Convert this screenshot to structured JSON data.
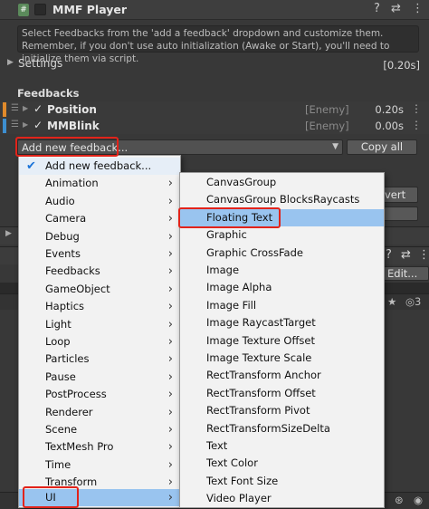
{
  "header": {
    "title": "MMF Player",
    "script_icon": "#",
    "help_icon": "?",
    "settings_icon": "⇄",
    "more_icon": "⋮"
  },
  "help_text": "Select Feedbacks from the 'add a feedback' dropdown and customize them. Remember, if you don't use auto initialization (Awake or Start), you'll need to initialize them via script.",
  "settings": {
    "label": "Settings",
    "duration": "[0.20s]"
  },
  "feedbacks": {
    "title": "Feedbacks",
    "items": [
      {
        "name": "Position",
        "tag": "[Enemy]",
        "time": "0.20s",
        "color": "#e08a2b"
      },
      {
        "name": "MMBlink",
        "tag": "[Enemy]",
        "time": "0.00s",
        "color": "#3d8fd0"
      }
    ]
  },
  "add_dropdown": {
    "label": "Add new feedback...",
    "copy_all": "Copy all"
  },
  "background_fragments": {
    "revert": "vert",
    "edit": "Edit..."
  },
  "menu_main": {
    "items": [
      {
        "label": "Add new feedback...",
        "checked": true,
        "submenu": false
      },
      {
        "label": "Animation",
        "submenu": true
      },
      {
        "label": "Audio",
        "submenu": true
      },
      {
        "label": "Camera",
        "submenu": true
      },
      {
        "label": "Debug",
        "submenu": true
      },
      {
        "label": "Events",
        "submenu": true
      },
      {
        "label": "Feedbacks",
        "submenu": true
      },
      {
        "label": "GameObject",
        "submenu": true
      },
      {
        "label": "Haptics",
        "submenu": true
      },
      {
        "label": "Light",
        "submenu": true
      },
      {
        "label": "Loop",
        "submenu": true
      },
      {
        "label": "Particles",
        "submenu": true
      },
      {
        "label": "Pause",
        "submenu": true
      },
      {
        "label": "PostProcess",
        "submenu": true
      },
      {
        "label": "Renderer",
        "submenu": true
      },
      {
        "label": "Scene",
        "submenu": true
      },
      {
        "label": "TextMesh Pro",
        "submenu": true
      },
      {
        "label": "Time",
        "submenu": true
      },
      {
        "label": "Transform",
        "submenu": true
      },
      {
        "label": "UI",
        "submenu": true,
        "selected": true
      }
    ]
  },
  "menu_ui": {
    "items": [
      {
        "label": "CanvasGroup"
      },
      {
        "label": "CanvasGroup BlocksRaycasts"
      },
      {
        "label": "Floating Text",
        "selected": true
      },
      {
        "label": "Graphic"
      },
      {
        "label": "Graphic CrossFade"
      },
      {
        "label": "Image"
      },
      {
        "label": "Image Alpha"
      },
      {
        "label": "Image Fill"
      },
      {
        "label": "Image RaycastTarget"
      },
      {
        "label": "Image Texture Offset"
      },
      {
        "label": "Image Texture Scale"
      },
      {
        "label": "RectTransform Anchor"
      },
      {
        "label": "RectTransform Offset"
      },
      {
        "label": "RectTransform Pivot"
      },
      {
        "label": "RectTransformSizeDelta"
      },
      {
        "label": "Text"
      },
      {
        "label": "Text Color"
      },
      {
        "label": "Text Font Size"
      },
      {
        "label": "Video Player"
      }
    ]
  },
  "colors": {
    "highlight_outline": "#e2231a",
    "menu_selection": "#99c4ef"
  }
}
